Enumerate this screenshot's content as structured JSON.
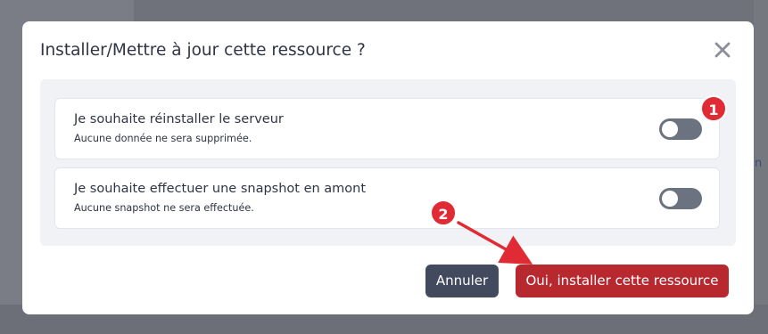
{
  "dialog": {
    "title": "Installer/Mettre à jour cette ressource ?",
    "options": [
      {
        "title": "Je souhaite réinstaller le serveur",
        "subtitle": "Aucune donnée ne sera supprimée.",
        "enabled": false
      },
      {
        "title": "Je souhaite effectuer une snapshot en amont",
        "subtitle": "Aucune snapshot ne sera effectuée.",
        "enabled": false
      }
    ],
    "cancel_label": "Annuler",
    "confirm_label": "Oui, installer cette ressource"
  },
  "annotations": {
    "step1": "1",
    "step2": "2"
  },
  "colors": {
    "confirm": "#b8282f",
    "cancel": "#424a5e",
    "toggle_off": "#6b7280",
    "badge": "#e02b35"
  }
}
